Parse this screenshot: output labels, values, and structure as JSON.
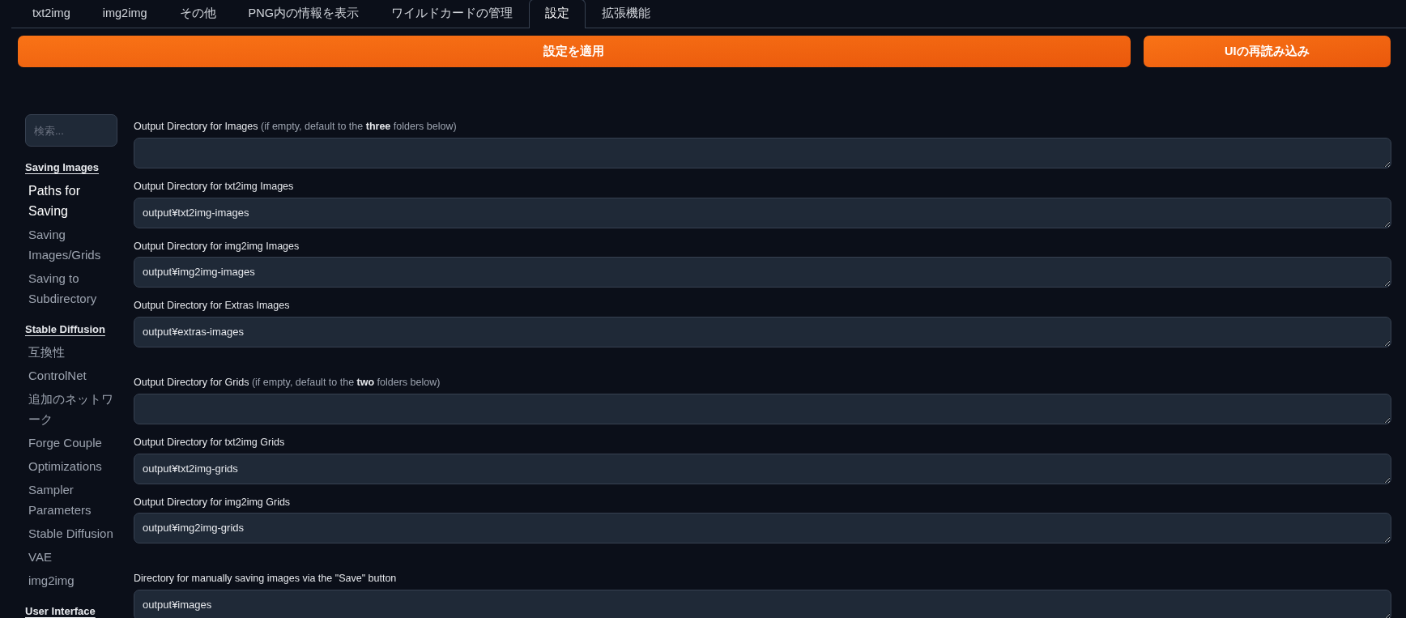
{
  "tabs": [
    {
      "label": "txt2img",
      "selected": false
    },
    {
      "label": "img2img",
      "selected": false
    },
    {
      "label": "その他",
      "selected": false
    },
    {
      "label": "PNG内の情報を表示",
      "selected": false
    },
    {
      "label": "ワイルドカードの管理",
      "selected": false
    },
    {
      "label": "設定",
      "selected": true
    },
    {
      "label": "拡張機能",
      "selected": false
    }
  ],
  "buttons": [
    "設定を適用",
    "UIの再読み込み"
  ],
  "sidebar": {
    "search": {
      "placeholder": "検索..."
    },
    "sections": [
      {
        "heading": "Saving Images",
        "items": [
          {
            "label": "Paths for Saving",
            "selected": true
          },
          {
            "label": "Saving Images/Grids",
            "selected": false
          },
          {
            "label": "Saving to Subdirectory",
            "selected": false
          }
        ]
      },
      {
        "heading": "Stable Diffusion",
        "items": [
          {
            "label": "互換性",
            "selected": false
          },
          {
            "label": "ControlNet",
            "selected": false
          },
          {
            "label": "追加のネットワーク",
            "selected": false
          },
          {
            "label": "Forge Couple",
            "selected": false
          },
          {
            "label": "Optimizations",
            "selected": false
          },
          {
            "label": "Sampler Parameters",
            "selected": false
          },
          {
            "label": "Stable Diffusion",
            "selected": false
          },
          {
            "label": "VAE",
            "selected": false
          },
          {
            "label": "img2img",
            "selected": false
          }
        ]
      },
      {
        "heading": "User Interface"
      }
    ]
  },
  "groups": [
    {
      "fields": [
        {
          "label": "Output Directory for Images",
          "note": "(if empty, default to the **three** folders below)"
        },
        {
          "label": "Output Directory for txt2img Images",
          "value": "output¥txt2img-images"
        },
        {
          "label": "Output Directory for img2img Images",
          "value": "output¥img2img-images"
        },
        {
          "label": "Output Directory for Extras Images",
          "value": "output¥extras-images"
        }
      ]
    },
    {
      "fields": [
        {
          "label": "Output Directory for Grids",
          "note": "(if empty, default to the **two** folders below)"
        },
        {
          "label": "Output Directory for txt2img Grids",
          "value": "output¥txt2img-grids"
        },
        {
          "label": "Output Directory for img2img Grids",
          "value": "output¥img2img-grids"
        }
      ]
    },
    {
      "fields": [
        {
          "label": "Directory for manually saving images via the \"Save\" button",
          "value": "output¥images"
        }
      ]
    }
  ]
}
